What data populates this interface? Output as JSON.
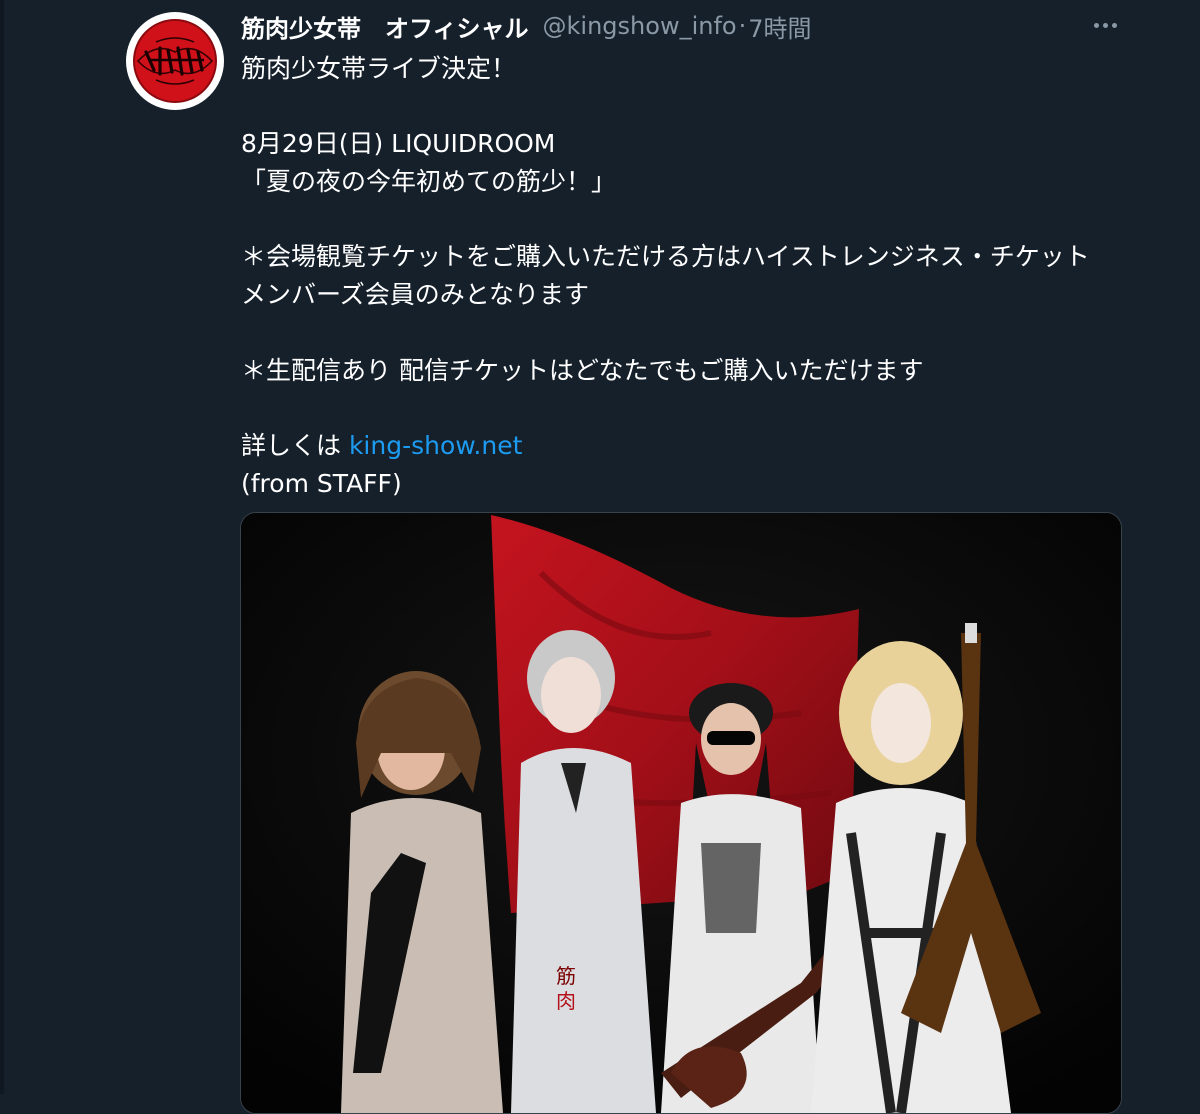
{
  "tweet": {
    "display_name": "筋肉少女帯　オフィシャル",
    "handle": "@kingshow_info",
    "separator": "·",
    "time": "7時間",
    "text": {
      "line1": "筋肉少女帯ライブ決定！",
      "line2": "8月29日(日) LIQUIDROOM",
      "line3": "「夏の夜の今年初めての筋少！」",
      "line4": "＊会場観覧チケットをご購入いただける方はハイストレンジネス・チケット",
      "line5": "メンバーズ会員のみとなります",
      "line6": "＊生配信あり 配信チケットはどなたでもご購入いただけます",
      "line7_prefix": "詳しくは ",
      "line7_link": "king-show.net",
      "line8": "(from STAFF)"
    },
    "media": {
      "type": "band-photo"
    }
  },
  "icons": {
    "more": "more-horizontal-icon",
    "avatar": "band-logo-avatar"
  },
  "colors": {
    "background": "#15202b",
    "text": "#ffffff",
    "secondary": "#8b98a5",
    "link": "#1d9bf0",
    "flag_red": "#b3121b"
  }
}
